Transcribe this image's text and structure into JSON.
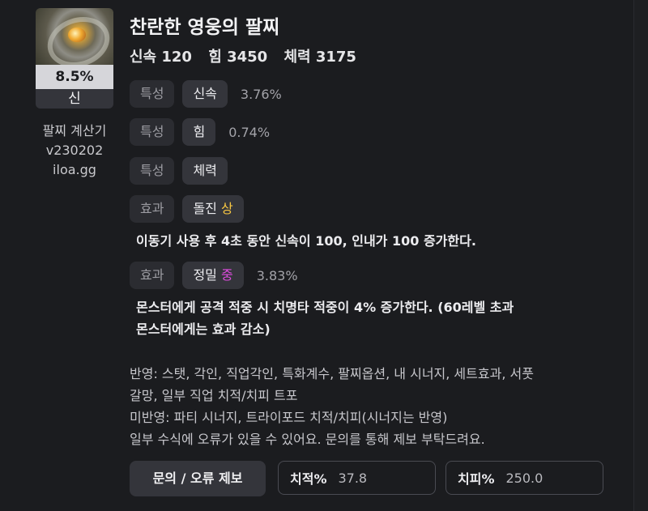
{
  "item": {
    "percent": "8.5%",
    "grade": "신",
    "name": "찬란한 영웅의 팔찌",
    "stats": [
      "신속 120",
      "힘 3450",
      "체력 3175"
    ]
  },
  "sidebar": {
    "app_name": "팔찌 계산기",
    "version": "v230202",
    "site": "iloa.gg"
  },
  "rows": [
    {
      "category": "특성",
      "value": "신속",
      "level": "",
      "percent": "3.76%"
    },
    {
      "category": "특성",
      "value": "힘",
      "level": "",
      "percent": "0.74%"
    },
    {
      "category": "특성",
      "value": "체력",
      "level": "",
      "percent": ""
    },
    {
      "category": "효과",
      "value": "돌진",
      "level": "상",
      "percent": "",
      "description": [
        "이동기 사용 후 4초 동안 신속이 100, 인내가 100 증가한다."
      ]
    },
    {
      "category": "효과",
      "value": "정밀",
      "level": "중",
      "percent": "3.83%",
      "description": [
        "몬스터에게 공격 적중 시 치명타 적중이 4% 증가한다. (60레벨 초과",
        "몬스터에게는 효과 감소)"
      ]
    }
  ],
  "notes": [
    "반영: 스탯, 각인, 직업각인, 특화계수, 팔찌옵션, 내 시너지, 세트효과, 서풋",
    "갈망, 일부 직업 치적/치피 트포",
    "미반영: 파티 시너지, 트라이포드 치적/치피(시너지는 반영)",
    "일부 수식에 오류가 있을 수 있어요. 문의를 통해 제보 부탁드려요."
  ],
  "controls": {
    "report_button": "문의 / 오류 제보",
    "crit_rate_label": "치적%",
    "crit_rate_value": "37.8",
    "crit_damage_label": "치피%",
    "crit_damage_value": "250.0"
  },
  "colors": {
    "level_high": "#f5c542",
    "level_mid": "#e04de0",
    "background": "#1b1c1f"
  }
}
